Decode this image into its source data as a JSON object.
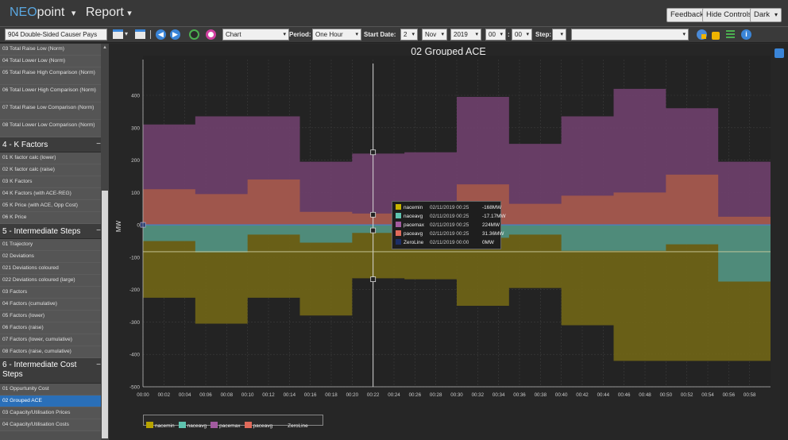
{
  "header": {
    "brand_neo": "NEO",
    "brand_point": "point",
    "brand_caret": "▾",
    "report_label": "Report",
    "report_caret": "▾",
    "feedback": "Feedback",
    "hide_controls": "Hide Controls",
    "theme": "Dark"
  },
  "toolbar": {
    "report_select": "904 Double-Sided Causer Pays",
    "view_select": "Chart",
    "period_label": "Period:",
    "period_value": "One Hour",
    "start_label": "Start Date:",
    "start_day": "2",
    "start_month": "Nov",
    "start_year": "2019",
    "start_hour": "00",
    "start_min": "00",
    "step_label": "Step:",
    "step_value": "",
    "extra_select": ""
  },
  "sidebar": {
    "group_top_items": [
      "03 Total Raise Low (Norm)",
      "04 Total Lower Low (Norm)",
      "05 Total Raise High Comparison (Norm)",
      "06 Total Lower High Comparison (Norm)",
      "07 Total Raise Low Comparison (Norm)",
      "08 Total Lower Low Comparison (Norm)"
    ],
    "k_factors_title": "4 - K Factors",
    "k_factors_items": [
      "01 K factor calc (lower)",
      "02 K factor calc (raise)",
      "03 K Factors",
      "04 K Factors (with ACE-REG)",
      "05 K Price (with ACE, Opp Cost)",
      "06 K Price"
    ],
    "intermediate_title": "5 - Intermediate Steps",
    "intermediate_items": [
      "01 Trajectory",
      "02 Deviations",
      "021 Deviations coloured",
      "022 Deviations coloured (large)",
      "03 Factors",
      "04 Factors (cumulative)",
      "05 Factors (lower)",
      "06 Factors (raise)",
      "07 Factors (lower, cumulative)",
      "08 Factors (raise, cumulative)"
    ],
    "cost_title": "6 - Intermediate Cost Steps",
    "cost_items": [
      "01 Oppurtunity Cost",
      "02 Grouped ACE",
      "03 Capacity/Utilisation Prices",
      "04 Capacity/Utilisation Costs"
    ],
    "minus": "−"
  },
  "tooltip": {
    "rows": [
      {
        "name": "nacemin",
        "time": "02/11/2019 00:25",
        "value": "-168MW",
        "color": "#c8b400"
      },
      {
        "name": "naceavg",
        "time": "02/11/2019 00:25",
        "value": "-17.17MW",
        "color": "#5fc4b0"
      },
      {
        "name": "pacemax",
        "time": "02/11/2019 00:25",
        "value": "224MW",
        "color": "#a25ba0"
      },
      {
        "name": "paceavg",
        "time": "02/11/2019 00:25",
        "value": "31.36MW",
        "color": "#e06a5a"
      },
      {
        "name": "ZeroLine",
        "time": "02/11/2019 00:00",
        "value": "0MW",
        "color": "#1c2e66"
      }
    ]
  },
  "legend": [
    {
      "name": "nacemin",
      "color": "#b8a400"
    },
    {
      "name": "naceavg",
      "color": "#5fc4b0"
    },
    {
      "name": "pacemax",
      "color": "#a25ba0"
    },
    {
      "name": "paceavg",
      "color": "#e06a5a"
    },
    {
      "name": "ZeroLine",
      "color": ""
    }
  ],
  "colors": {
    "nacemin": "#6e6317",
    "naceavg": "#4e8d7f",
    "pacemax": "#6c3f69",
    "paceavg": "#a2574b",
    "zero": "#4a7fc4",
    "accent": "#2a6fb8"
  },
  "chart_data": {
    "type": "area",
    "title": "02 Grouped ACE",
    "xlabel": "",
    "ylabel": "MW",
    "ylim": [
      -500,
      450
    ],
    "yticks": [
      -500,
      -400,
      -300,
      -200,
      -100,
      0,
      100,
      200,
      300,
      400
    ],
    "xtick_labels": [
      "00:00",
      "00:02",
      "00:04",
      "00:06",
      "00:08",
      "00:10",
      "00:12",
      "00:14",
      "00:16",
      "00:18",
      "00:20",
      "00:22",
      "00:24",
      "00:26",
      "00:28",
      "00:30",
      "00:32",
      "00:34",
      "00:36",
      "00:38",
      "00:40",
      "00:42",
      "00:44",
      "00:46",
      "00:48",
      "00:50",
      "00:52",
      "00:54",
      "00:56",
      "00:58"
    ],
    "step": "5-minute intervals",
    "x": [
      "00:00",
      "00:05",
      "00:10",
      "00:15",
      "00:20",
      "00:25",
      "00:30",
      "00:35",
      "00:40",
      "00:45",
      "00:50",
      "00:55"
    ],
    "series": [
      {
        "name": "pacemax",
        "values": [
          310,
          335,
          335,
          195,
          220,
          224,
          395,
          250,
          335,
          420,
          360,
          195,
          170
        ]
      },
      {
        "name": "paceavg",
        "values": [
          110,
          95,
          140,
          40,
          35,
          31.36,
          125,
          65,
          90,
          100,
          155,
          25,
          25
        ]
      },
      {
        "name": "naceavg",
        "values": [
          -50,
          -85,
          -30,
          -55,
          -25,
          -17.17,
          -40,
          -30,
          -80,
          -80,
          -60,
          -175,
          -70
        ]
      },
      {
        "name": "nacemin",
        "values": [
          -225,
          -305,
          -225,
          -280,
          -165,
          -168,
          -250,
          -195,
          -310,
          -420,
          -420,
          -420,
          -225
        ]
      },
      {
        "name": "ZeroLine",
        "values": [
          0,
          0,
          0,
          0,
          0,
          0,
          0,
          0,
          0,
          0,
          0,
          0,
          0
        ]
      }
    ],
    "crosshair_x": "00:22",
    "grid": true
  }
}
